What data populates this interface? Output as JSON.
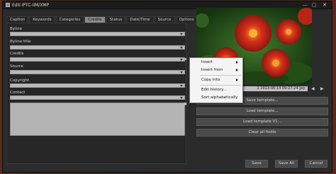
{
  "window": {
    "title": "Edit IPTC-IIM/XMP",
    "minimize": "—",
    "maximize": "▢",
    "close": "✕"
  },
  "tabs": [
    "Caption",
    "Keywords",
    "Categories",
    "Credits",
    "Status",
    "Date/Time",
    "Source",
    "Options"
  ],
  "active_tab": "Credits",
  "fields": {
    "byline": {
      "label": "Byline",
      "value": ""
    },
    "byline_title": {
      "label": "Byline title",
      "value": ""
    },
    "credits": {
      "label": "Credits",
      "value": ""
    },
    "source": {
      "label": "Source",
      "value": ""
    },
    "copyright": {
      "label": "Copyright",
      "value": ""
    },
    "contact": {
      "label": "Contact",
      "value": ""
    }
  },
  "context_menu": {
    "items": [
      {
        "label": "Insert",
        "submenu": true
      },
      {
        "label": "Insert from",
        "submenu": true
      },
      {
        "label": "Copy into",
        "submenu": true
      },
      {
        "label": "Edit history...",
        "submenu": false
      },
      {
        "label": "Sort alphabetically",
        "submenu": false
      }
    ]
  },
  "preview": {
    "filename": "2 2013-06-14 09-27-24.jpg",
    "prev": "◀",
    "next": "▶"
  },
  "buttons": {
    "save_template": "Save template...",
    "load_template": "Load template...",
    "load_template_v1": "Load template V1...",
    "clear_all": "Clear all fields",
    "save": "Save",
    "save_all": "Save All",
    "cancel": "Cancel"
  },
  "colors": {
    "window_bg": "#2b2b2b",
    "active_tab": "#8a8a8a",
    "field_bg": "#b9b9b9",
    "button_bg": "#4a4a4a",
    "menu_bg": "#f4f4f4"
  }
}
